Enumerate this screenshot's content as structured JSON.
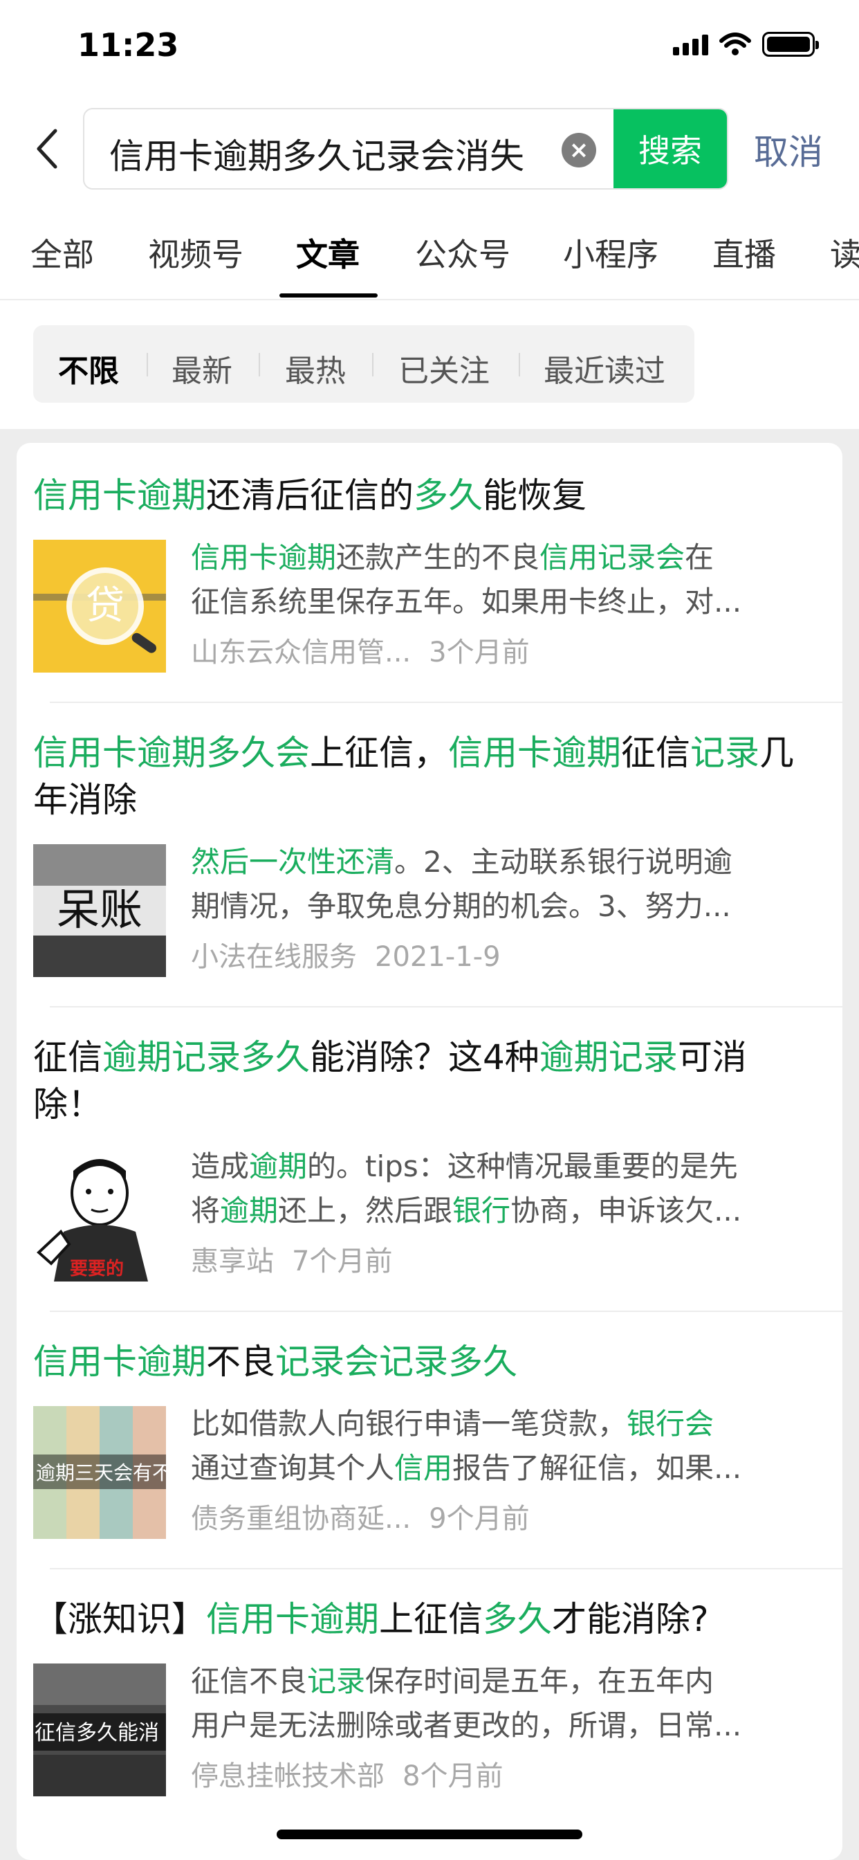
{
  "status_bar": {
    "time": "11:23"
  },
  "search": {
    "query": "信用卡逾期多久记录会消失",
    "search_button": "搜索",
    "cancel_button": "取消"
  },
  "tabs": [
    "全部",
    "视频号",
    "文章",
    "公众号",
    "小程序",
    "直播",
    "读"
  ],
  "active_tab": "文章",
  "filters": [
    "不限",
    "最新",
    "最热",
    "已关注",
    "最近读过"
  ],
  "active_filter": "不限",
  "results": [
    {
      "title": [
        {
          "t": "信用卡逾期",
          "hl": true
        },
        {
          "t": "还清后征信的",
          "hl": false
        },
        {
          "t": "多久",
          "hl": true
        },
        {
          "t": "能恢复",
          "hl": false
        }
      ],
      "snippet_lines": [
        [
          {
            "t": "信用卡逾期",
            "hl": true
          },
          {
            "t": "还款产生的不良",
            "hl": false
          },
          {
            "t": "信用记录会",
            "hl": true
          },
          {
            "t": "在",
            "hl": false
          }
        ],
        [
          {
            "t": "征信系统里保存五年。如果用卡终止，对...",
            "hl": false
          }
        ]
      ],
      "source": "山东云众信用管...",
      "time": "3个月前",
      "thumb_text": "贷",
      "thumb_icon": "magnifier-loan-image"
    },
    {
      "title": [
        {
          "t": "信用卡逾期多久会",
          "hl": true
        },
        {
          "t": "上征信，",
          "hl": false
        },
        {
          "t": "信用卡逾期",
          "hl": true
        },
        {
          "t": "征信",
          "hl": false
        },
        {
          "t": "记录",
          "hl": true
        },
        {
          "t": "几年消除",
          "hl": false
        }
      ],
      "snippet_lines": [
        [
          {
            "t": "然后一次性还清",
            "hl": true
          },
          {
            "t": "。2、主动联系银行说明逾",
            "hl": false
          }
        ],
        [
          {
            "t": "期情况，争取免息分期的机会。3、努力...",
            "hl": false
          }
        ]
      ],
      "source": "小法在线服务",
      "time": "2021-1-9",
      "thumb_text": "呆账",
      "thumb_icon": "bad-debt-card-image"
    },
    {
      "title": [
        {
          "t": "征信",
          "hl": false
        },
        {
          "t": "逾期记录多久",
          "hl": true
        },
        {
          "t": "能消除？这4种",
          "hl": false
        },
        {
          "t": "逾期记录",
          "hl": true
        },
        {
          "t": "可消除！",
          "hl": false
        }
      ],
      "snippet_lines": [
        [
          {
            "t": "造成",
            "hl": false
          },
          {
            "t": "逾期",
            "hl": true
          },
          {
            "t": "的。tips：这种情况最重要的是先",
            "hl": false
          }
        ],
        [
          {
            "t": "将",
            "hl": false
          },
          {
            "t": "逾期",
            "hl": true
          },
          {
            "t": "还上，然后跟",
            "hl": false
          },
          {
            "t": "银行",
            "hl": true
          },
          {
            "t": "协商，申诉该欠...",
            "hl": false
          }
        ]
      ],
      "source": "惠享站",
      "time": "7个月前",
      "thumb_text": "要要的",
      "thumb_icon": "cartoon-man-meme-image"
    },
    {
      "title": [
        {
          "t": "信用卡逾期",
          "hl": true
        },
        {
          "t": "不良",
          "hl": false
        },
        {
          "t": "记录会记录多久",
          "hl": true
        }
      ],
      "snippet_lines": [
        [
          {
            "t": "比如借款人向银行申请一笔贷款，",
            "hl": false
          },
          {
            "t": "银行会",
            "hl": true
          }
        ],
        [
          {
            "t": "通过查询其个人",
            "hl": false
          },
          {
            "t": "信用",
            "hl": true
          },
          {
            "t": "报告了解征信，如果...",
            "hl": false
          }
        ]
      ],
      "source": "债务重组协商延...",
      "time": "9个月前",
      "thumb_text": "逾期三天会有不良",
      "thumb_icon": "pastel-stripes-image"
    },
    {
      "title": [
        {
          "t": "【涨知识】",
          "hl": false
        },
        {
          "t": "信用卡逾期",
          "hl": true
        },
        {
          "t": "上征信",
          "hl": false
        },
        {
          "t": "多久",
          "hl": true
        },
        {
          "t": "才能消除?",
          "hl": false
        }
      ],
      "snippet_lines": [
        [
          {
            "t": "征信不良",
            "hl": false
          },
          {
            "t": "记录",
            "hl": true
          },
          {
            "t": "保存时间是五年，在五年内",
            "hl": false
          }
        ],
        [
          {
            "t": "用户是无法删除或者更改的，所谓，日常...",
            "hl": false
          }
        ]
      ],
      "source": "停息挂帐技术部",
      "time": "8个月前",
      "thumb_text": "征信多久能消",
      "thumb_icon": "dark-texture-image"
    }
  ]
}
